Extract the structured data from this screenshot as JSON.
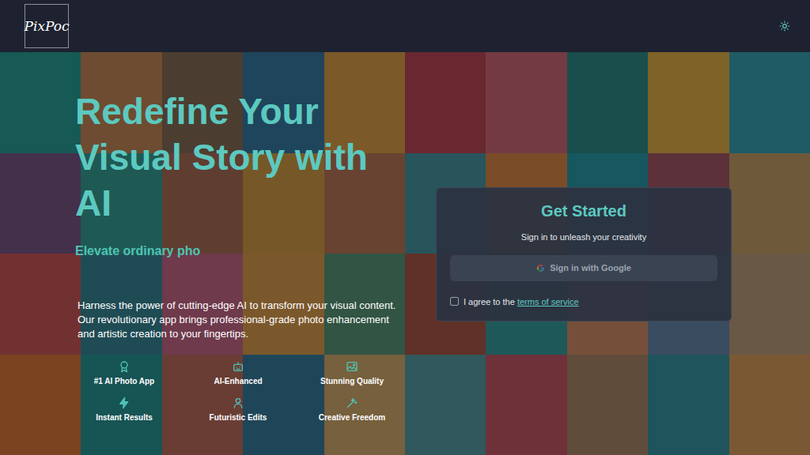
{
  "header": {
    "logo": "PixPoc"
  },
  "hero": {
    "title": "Redefine Your Visual Story with AI",
    "subtitle": "Elevate ordinary pho",
    "description": "Harness the power of cutting-edge AI to transform your visual content. Our revolutionary app brings professional-grade photo enhancement and artistic creation to your fingertips."
  },
  "features": [
    {
      "label": "#1 AI Photo App"
    },
    {
      "label": "AI-Enhanced"
    },
    {
      "label": "Stunning Quality"
    },
    {
      "label": "Instant Results"
    },
    {
      "label": "Futuristic Edits"
    },
    {
      "label": "Creative Freedom"
    }
  ],
  "signin": {
    "title": "Get Started",
    "subtitle": "Sign in to unleash your creativity",
    "button": {
      "label": "Sign in with Google",
      "disabled": true
    },
    "terms": {
      "text": "I agree to the ",
      "link": "terms of service",
      "checked": false
    }
  }
}
